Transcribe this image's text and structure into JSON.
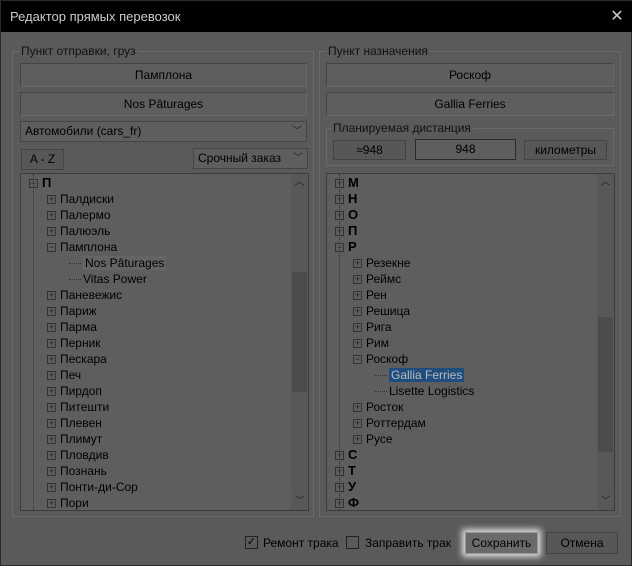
{
  "title": "Редактор прямых перевозок",
  "close_icon": "close-icon",
  "source": {
    "group_label": "Пункт отправки, груз",
    "city": "Памплона",
    "company": "Nos Pâturages",
    "cargo": "Автомобили (cars_fr)",
    "sort_label": "A - Z",
    "job_type": "Срочный заказ",
    "tree": [
      {
        "text": "П",
        "level": 0,
        "bold": true,
        "expander": "minus"
      },
      {
        "text": "Палдиски",
        "level": 1,
        "expander": "plus"
      },
      {
        "text": "Палермо",
        "level": 1,
        "expander": "plus"
      },
      {
        "text": "Палюэль",
        "level": 1,
        "expander": "plus"
      },
      {
        "text": "Памплона",
        "level": 1,
        "expander": "minus"
      },
      {
        "text": "Nos Pâturages",
        "level": 2,
        "state": "highlight"
      },
      {
        "text": "Vitas Power",
        "level": 2
      },
      {
        "text": "Паневежис",
        "level": 1,
        "expander": "plus"
      },
      {
        "text": "Париж",
        "level": 1,
        "expander": "plus"
      },
      {
        "text": "Парма",
        "level": 1,
        "expander": "plus"
      },
      {
        "text": "Перник",
        "level": 1,
        "expander": "plus"
      },
      {
        "text": "Пескара",
        "level": 1,
        "expander": "plus"
      },
      {
        "text": "Печ",
        "level": 1,
        "expander": "plus"
      },
      {
        "text": "Пирдоп",
        "level": 1,
        "expander": "plus"
      },
      {
        "text": "Питешти",
        "level": 1,
        "expander": "plus"
      },
      {
        "text": "Плевен",
        "level": 1,
        "expander": "plus"
      },
      {
        "text": "Плимут",
        "level": 1,
        "expander": "plus"
      },
      {
        "text": "Пловдив",
        "level": 1,
        "expander": "plus"
      },
      {
        "text": "Познань",
        "level": 1,
        "expander": "plus"
      },
      {
        "text": "Понти-ди-Сор",
        "level": 1,
        "expander": "plus"
      },
      {
        "text": "Пори",
        "level": 1,
        "expander": "plus"
      }
    ],
    "scroll_position": 0.45
  },
  "destination": {
    "group_label": "Пункт назначения",
    "city": "Роскоф",
    "company": "Gallia Ferries",
    "distance": {
      "label": "Планируемая дистанция",
      "approx": "≈948",
      "value": "948",
      "unit": "километры"
    },
    "tree": [
      {
        "text": "М",
        "level": 0,
        "bold": true,
        "expander": "plus"
      },
      {
        "text": "Н",
        "level": 0,
        "bold": true,
        "expander": "plus"
      },
      {
        "text": "О",
        "level": 0,
        "bold": true,
        "expander": "plus"
      },
      {
        "text": "П",
        "level": 0,
        "bold": true,
        "expander": "plus"
      },
      {
        "text": "Р",
        "level": 0,
        "bold": true,
        "expander": "minus"
      },
      {
        "text": "Резекне",
        "level": 1,
        "expander": "plus"
      },
      {
        "text": "Реймс",
        "level": 1,
        "expander": "plus"
      },
      {
        "text": "Рен",
        "level": 1,
        "expander": "plus"
      },
      {
        "text": "Решица",
        "level": 1,
        "expander": "plus"
      },
      {
        "text": "Рига",
        "level": 1,
        "expander": "plus"
      },
      {
        "text": "Рим",
        "level": 1,
        "expander": "plus"
      },
      {
        "text": "Роскоф",
        "level": 1,
        "expander": "minus"
      },
      {
        "text": "Gallia Ferries",
        "level": 2,
        "state": "selected"
      },
      {
        "text": "Lisette Logistics",
        "level": 2
      },
      {
        "text": "Росток",
        "level": 1,
        "expander": "plus"
      },
      {
        "text": "Роттердам",
        "level": 1,
        "expander": "plus"
      },
      {
        "text": "Русе",
        "level": 1,
        "expander": "plus"
      },
      {
        "text": "С",
        "level": 0,
        "bold": true,
        "expander": "plus"
      },
      {
        "text": "Т",
        "level": 0,
        "bold": true,
        "expander": "plus"
      },
      {
        "text": "У",
        "level": 0,
        "bold": true,
        "expander": "plus"
      },
      {
        "text": "Ф",
        "level": 0,
        "bold": true,
        "expander": "plus"
      }
    ],
    "scroll_position": 0.6
  },
  "footer": {
    "repair_label": "Ремонт трака",
    "repair_checked": true,
    "refuel_label": "Заправить трак",
    "refuel_checked": false,
    "save_label": "Сохранить",
    "cancel_label": "Отмена"
  },
  "colors": {
    "background": "#5a5a5a",
    "selection": "#1f4e7e",
    "titlebar": "#000000"
  }
}
